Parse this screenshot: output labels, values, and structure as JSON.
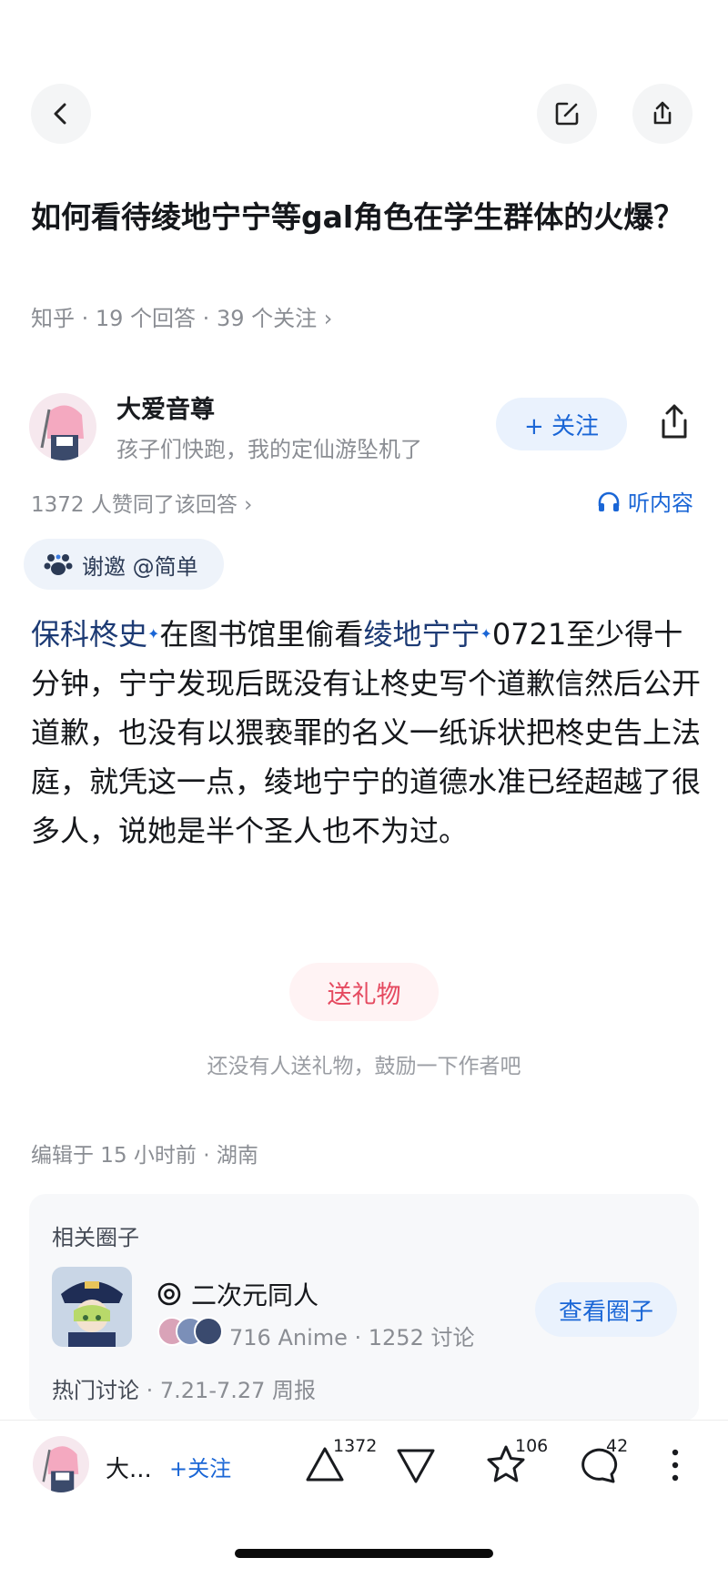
{
  "question": {
    "title": "如何看待绫地宁宁等gal角色在学生群体的火爆？",
    "meta": "知乎 · 19 个回答 · 39 个关注 ›"
  },
  "author": {
    "name": "大爱音尊",
    "signature": "孩子们快跑，我的定仙游坠机了",
    "follow_label": "+ 关注"
  },
  "answer": {
    "likes_line": "1372 人赞同了该回答 ›",
    "listen_label": "听内容",
    "invite_label": "谢邀 @简单",
    "link1": "保科柊史",
    "text1": "在图书馆里偷看",
    "link2": "绫地宁宁",
    "text2": "0721至少得十分钟，宁宁发现后既没有让柊史写个道歉信然后公开道歉，也没有以猥亵罪的名义一纸诉状把柊史告上法庭，就凭这一点，绫地宁宁的道德水准已经超越了很多人，说她是半个圣人也不为过。",
    "link_mark": "✦"
  },
  "gift": {
    "button_label": "送礼物",
    "hint": "还没有人送礼物，鼓励一下作者吧"
  },
  "edit_info": "编辑于 15 小时前 · 湖南",
  "related_circle": {
    "section_title": "相关圈子",
    "name": "二次元同人",
    "stats": "716 Anime · 1252 讨论",
    "view_label": "查看圈子",
    "hot_label": "热门讨论",
    "hot_detail": " · 7.21-7.27 周报"
  },
  "bottom_bar": {
    "author_short": "大...",
    "follow_label": "+关注",
    "upvote_count": "1372",
    "favorite_count": "106",
    "comment_count": "42"
  },
  "colors": {
    "accent": "#1a66d6",
    "gift": "#e54a60",
    "muted": "#8a8d93"
  },
  "icons": [
    "back-icon",
    "edit-icon",
    "share-icon",
    "plus-icon",
    "headphone-icon",
    "paw-icon",
    "circle-at-icon",
    "upvote-icon",
    "downvote-icon",
    "star-icon",
    "comment-icon",
    "more-icon"
  ]
}
